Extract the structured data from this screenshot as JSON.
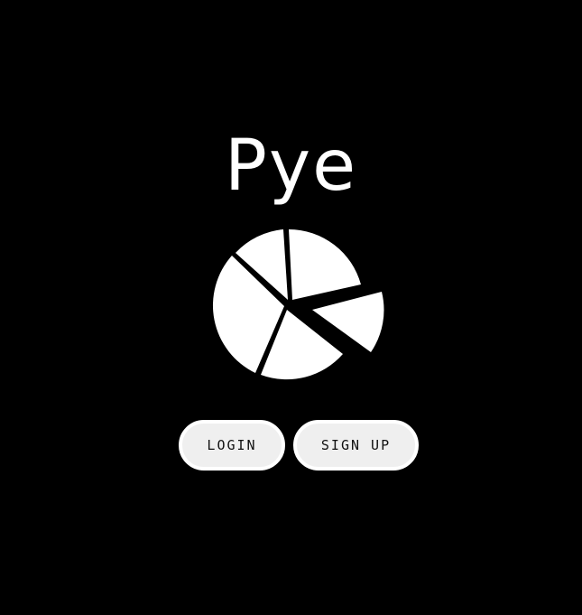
{
  "app": {
    "title": "Pye"
  },
  "logo": {
    "icon": "pie-chart-icon",
    "color": "#ffffff"
  },
  "buttons": {
    "login_label": "LOGIN",
    "signup_label": "SIGN UP"
  },
  "colors": {
    "background": "#000000",
    "button_fill": "#efefef",
    "button_border": "#ffffff",
    "button_text": "#111111"
  }
}
